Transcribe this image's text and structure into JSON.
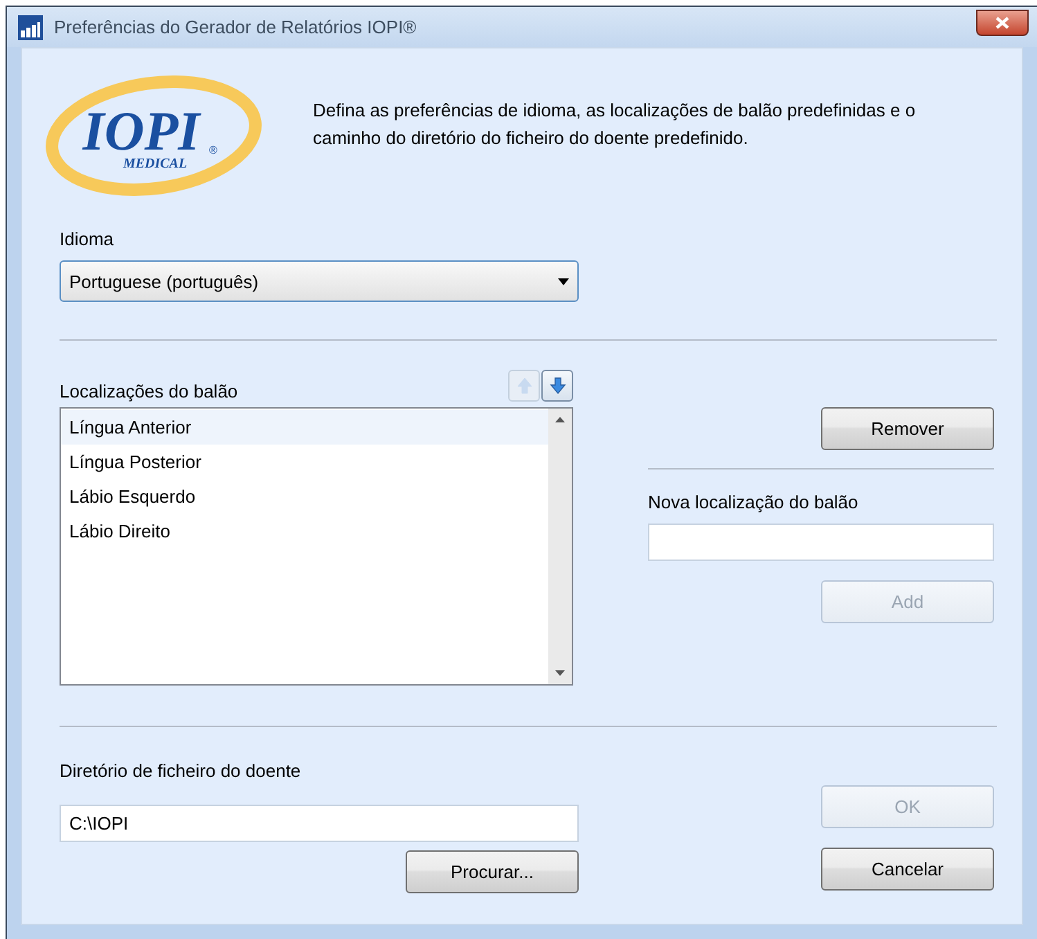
{
  "window": {
    "title": "Preferências do Gerador de Relatórios IOPI®"
  },
  "logo": {
    "wordmark": "IOPI",
    "registered": "®",
    "tagline": "MEDICAL"
  },
  "intro": "Defina as preferências de idioma, as localizações de balão predefinidas e o caminho do diretório do ficheiro do doente predefinido.",
  "language": {
    "label": "Idioma",
    "value": "Portuguese (português)"
  },
  "locations": {
    "label": "Localizações do balão",
    "move_up": {
      "disabled": true
    },
    "move_down": {
      "disabled": false
    },
    "items": [
      {
        "label": "Língua Anterior",
        "selected": true
      },
      {
        "label": "Língua Posterior",
        "selected": false
      },
      {
        "label": "Lábio Esquerdo",
        "selected": false
      },
      {
        "label": "Lábio Direito",
        "selected": false
      }
    ]
  },
  "remove_button": {
    "label": "Remover",
    "disabled": false
  },
  "new_location": {
    "label": "Nova localização do balão"
  },
  "add_button": {
    "label": "Add",
    "disabled": true
  },
  "patient_dir": {
    "label": "Diretório de ficheiro do doente",
    "value": "C:\\IOPI"
  },
  "browse_button": {
    "label": "Procurar...",
    "disabled": false
  },
  "ok_button": {
    "label": "OK",
    "disabled": true
  },
  "cancel_button": {
    "label": "Cancelar",
    "disabled": false
  }
}
